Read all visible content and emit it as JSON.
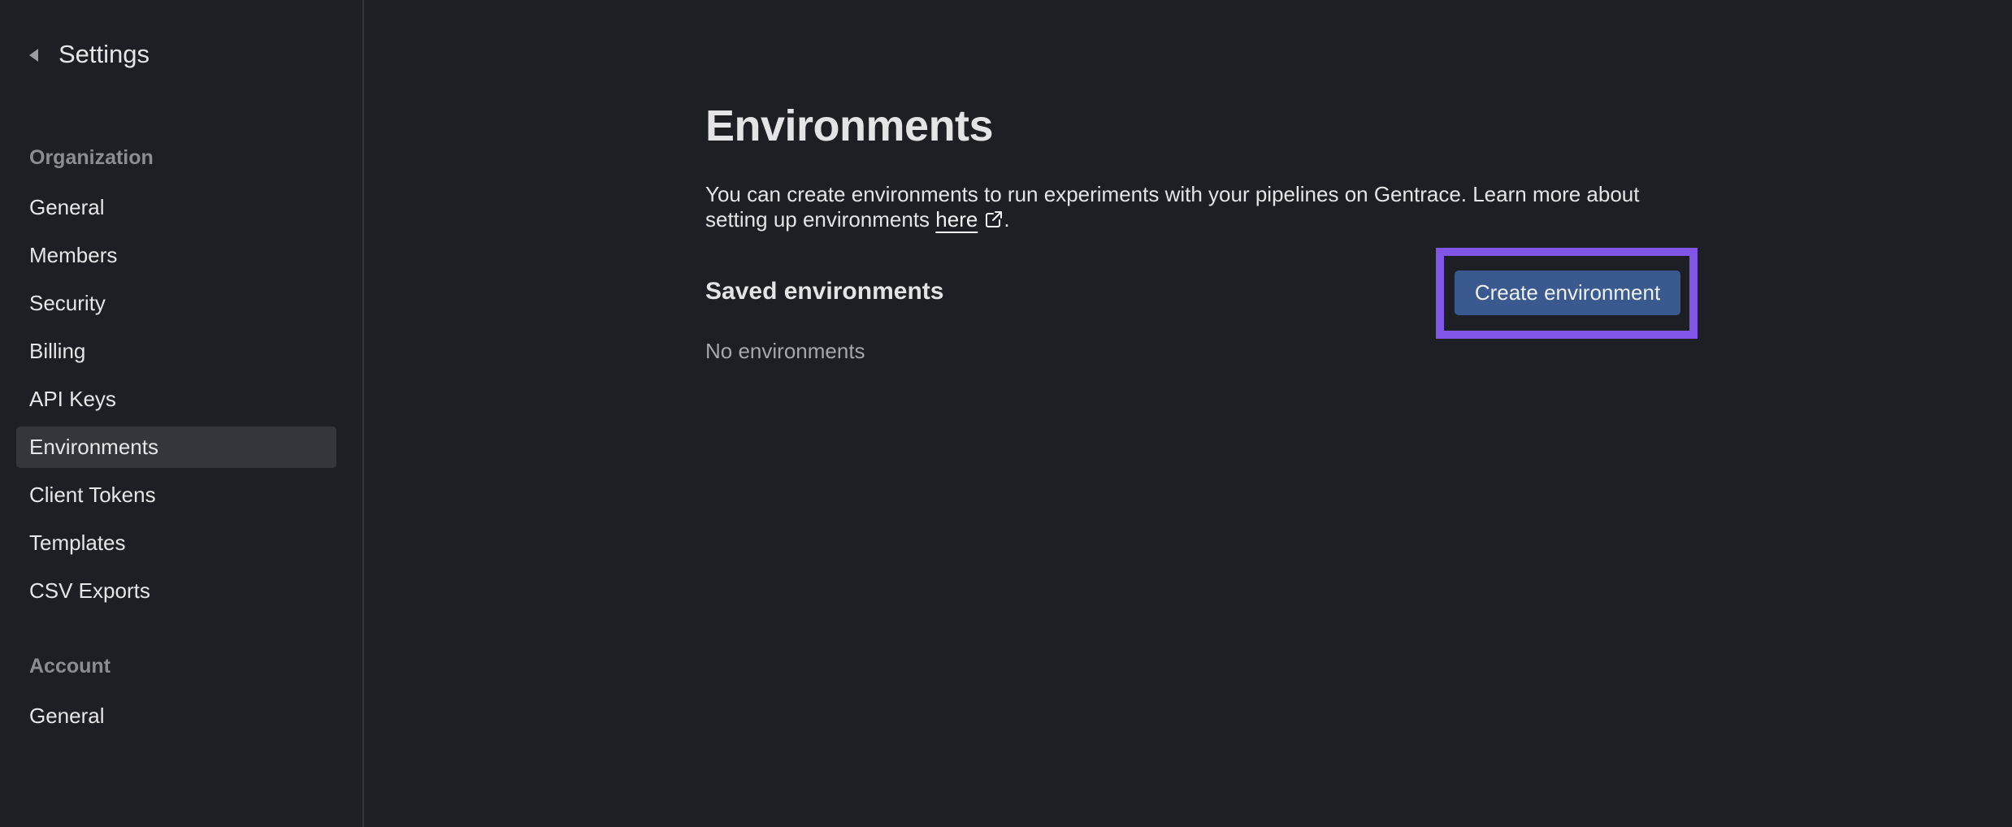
{
  "sidebar": {
    "back_label": "Settings",
    "sections": [
      {
        "label": "Organization",
        "items": [
          {
            "label": "General",
            "active": false
          },
          {
            "label": "Members",
            "active": false
          },
          {
            "label": "Security",
            "active": false
          },
          {
            "label": "Billing",
            "active": false
          },
          {
            "label": "API Keys",
            "active": false
          },
          {
            "label": "Environments",
            "active": true
          },
          {
            "label": "Client Tokens",
            "active": false
          },
          {
            "label": "Templates",
            "active": false
          },
          {
            "label": "CSV Exports",
            "active": false
          }
        ]
      },
      {
        "label": "Account",
        "items": [
          {
            "label": "General",
            "active": false
          }
        ]
      }
    ]
  },
  "main": {
    "title": "Environments",
    "description_before": "You can create environments to run experiments with your pipelines on Gentrace. Learn more about setting up environments ",
    "link_text": "here",
    "link_icon": "external-link-icon",
    "description_after": ".",
    "saved_title": "Saved environments",
    "empty_text": "No environments",
    "create_button_label": "Create environment"
  },
  "colors": {
    "background": "#1e1f24",
    "active_item": "#35363b",
    "primary_button": "#3a5a8f",
    "highlight_outline": "#8155e8"
  }
}
